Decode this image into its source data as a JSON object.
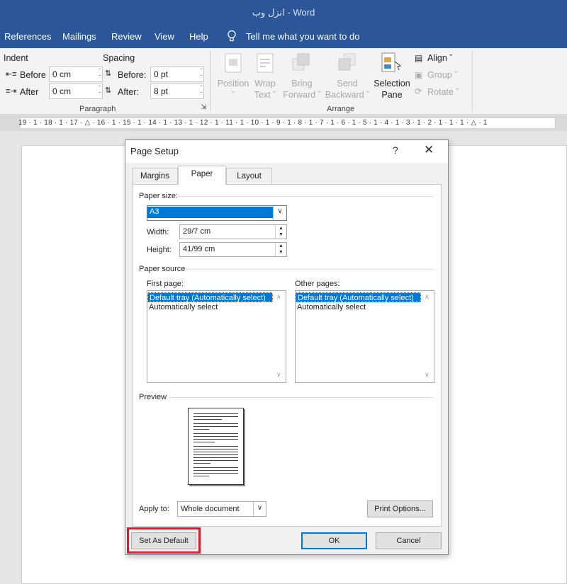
{
  "window": {
    "title": "انزل وب  -  Word"
  },
  "ribbon_tabs": [
    "References",
    "Mailings",
    "Review",
    "View",
    "Help"
  ],
  "tell_me": "Tell me what you want to do",
  "paragraph": {
    "indent_label": "Indent",
    "spacing_label": "Spacing",
    "indent_before_label": "Before",
    "indent_before_value": "0 cm",
    "indent_after_label": "After",
    "indent_after_value": "0 cm",
    "spacing_before_label": "Before:",
    "spacing_before_value": "0 pt",
    "spacing_after_label": "After:",
    "spacing_after_value": "8 pt",
    "group_label": "Paragraph"
  },
  "arrange": {
    "position": [
      "Position",
      "ˇ"
    ],
    "wrap_text": [
      "Wrap",
      "Text ˇ"
    ],
    "bring_forward": [
      "Bring",
      "Forward ˇ"
    ],
    "send_backward": [
      "Send",
      "Backward ˇ"
    ],
    "selection_pane": [
      "Selection",
      "Pane"
    ],
    "align": "Align ˇ",
    "group": "Group ˇ",
    "rotate": "Rotate ˇ",
    "group_label": "Arrange"
  },
  "ruler_text": "19 · 1 · 18 · 1 · 17 · △ · 16 · 1 · 15 · 1 · 14 · 1 · 13 · 1 · 12 · 1 · 11 · 1 · 10 · 1 · 9 · 1 · 8 · 1 · 7 · 1 · 6 · 1 · 5 · 1 · 4 · 1 · 3 · 1 · 2 · 1 · 1 · 1 · △ · 1",
  "dialog": {
    "title": "Page Setup",
    "help": "?",
    "close": "✕",
    "tabs": [
      "Margins",
      "Paper",
      "Layout"
    ],
    "paper_size_label": "Paper size:",
    "paper_size_value": "A3",
    "width_label": "Width:",
    "width_value": "29/7 cm",
    "height_label": "Height:",
    "height_value": "41/99 cm",
    "paper_source_label": "Paper source",
    "first_page_label": "First page:",
    "other_pages_label": "Other pages:",
    "first_page_options": [
      "Default tray (Automatically select)",
      "Automatically select"
    ],
    "other_pages_options": [
      "Default tray (Automatically select)",
      "Automatically select"
    ],
    "preview_label": "Preview",
    "apply_to_label": "Apply to:",
    "apply_to_value": "Whole document",
    "print_options": "Print Options...",
    "set_as_default": "Set As Default",
    "ok": "OK",
    "cancel": "Cancel"
  },
  "colors": {
    "title_bar": "#2b579a",
    "selection": "#0078d7",
    "highlight": "#e0192a"
  }
}
